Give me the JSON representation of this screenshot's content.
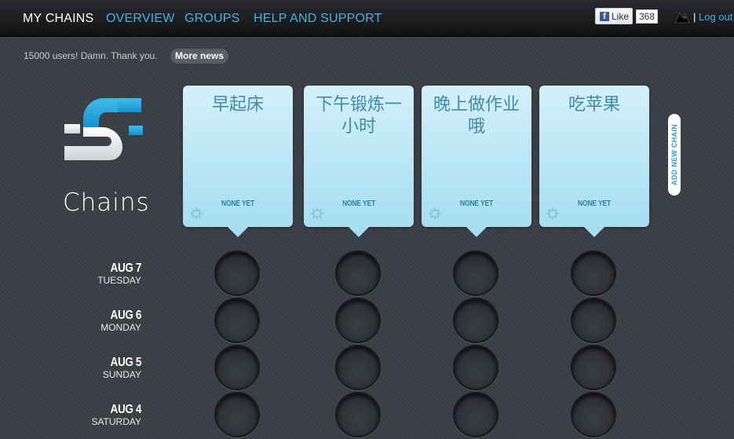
{
  "nav": {
    "items": [
      {
        "label": "MY CHAINS",
        "active": true
      },
      {
        "label": "OVERVIEW",
        "active": false
      },
      {
        "label": "GROUPS",
        "active": false
      },
      {
        "label": "HELP AND SUPPORT",
        "active": false
      }
    ]
  },
  "social": {
    "like_label": "Like",
    "like_count": "368"
  },
  "account": {
    "separator": "|",
    "logout_label": "Log out"
  },
  "news": {
    "text": "15000 users! Damn. Thank you.",
    "more_label": "More news"
  },
  "logo": {
    "text": "Chains"
  },
  "chains": [
    {
      "title": "早起床",
      "status": "NONE YET"
    },
    {
      "title": "下午锻炼一小时",
      "status": "NONE YET"
    },
    {
      "title": "晚上做作业哦",
      "status": "NONE YET"
    },
    {
      "title": "吃苹果",
      "status": "NONE YET"
    }
  ],
  "add_chain_label": "ADD NEW CHAIN",
  "days": [
    {
      "date": "AUG 7",
      "weekday": "TUESDAY"
    },
    {
      "date": "AUG 6",
      "weekday": "MONDAY"
    },
    {
      "date": "AUG 5",
      "weekday": "SUNDAY"
    },
    {
      "date": "AUG 4",
      "weekday": "SATURDAY"
    }
  ],
  "colors": {
    "accent": "#3fb6e6",
    "card_top": "#d3f0fb",
    "card_bottom": "#a6def0",
    "logo_blue": "#1e9fdc"
  }
}
